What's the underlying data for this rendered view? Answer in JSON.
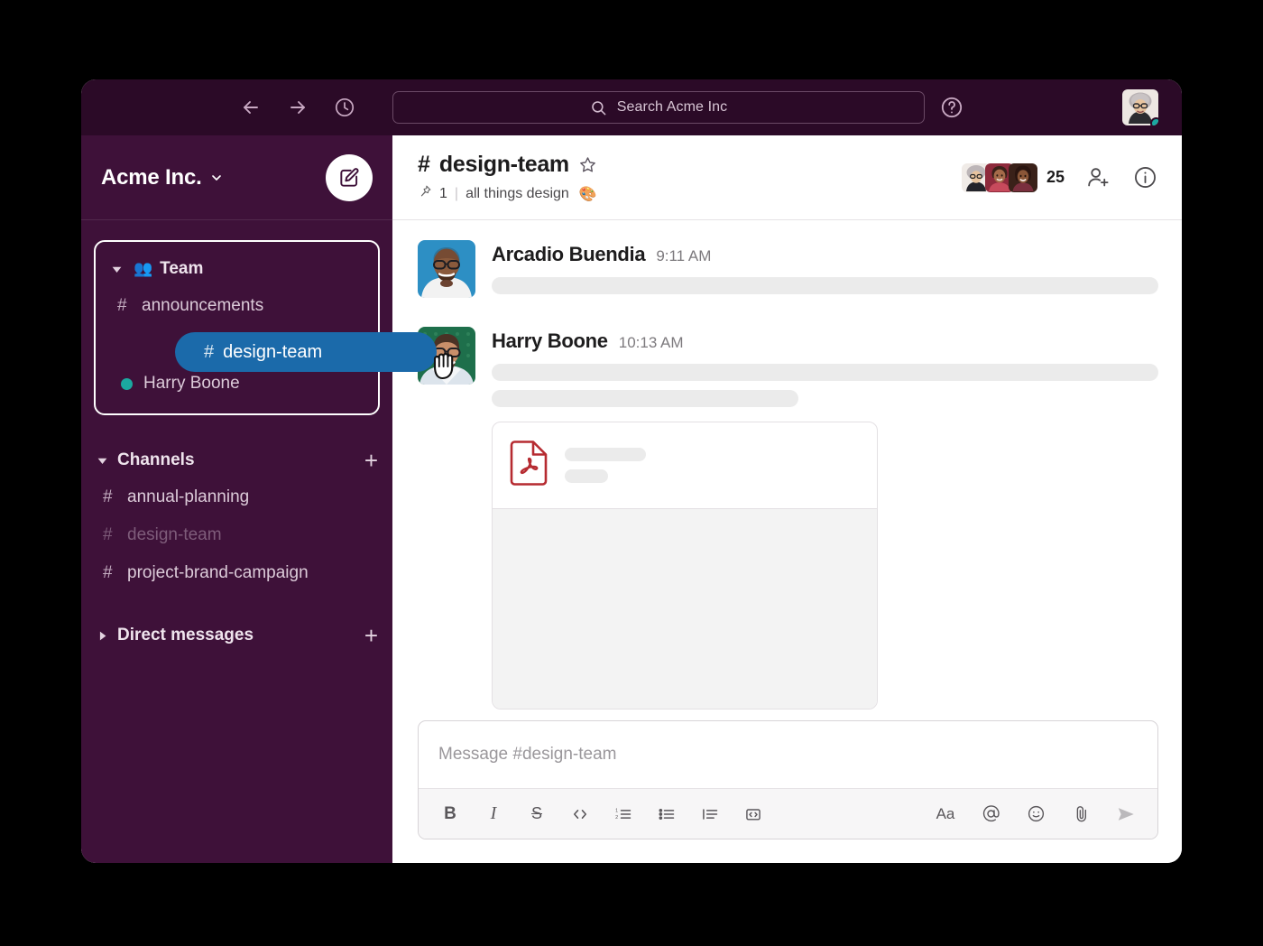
{
  "topbar": {
    "back_icon": "arrow-left-icon",
    "forward_icon": "arrow-right-icon",
    "history_icon": "clock-icon",
    "search_placeholder": "Search Acme Inc",
    "search_icon": "search-icon",
    "help_icon": "question-circle-icon",
    "avatar_icon": "user-avatar"
  },
  "sidebar": {
    "workspace_name": "Acme Inc.",
    "workspace_caret_icon": "chevron-down-icon",
    "compose_icon": "compose-pencil-icon",
    "team_section": {
      "label": "Team",
      "emoji": "👥",
      "caret_icon": "caret-down-icon",
      "items": [
        {
          "type": "channel",
          "hash": "#",
          "label": "announcements",
          "muted": false
        },
        {
          "type": "member",
          "label": "Harry Boone",
          "presence": "active"
        }
      ]
    },
    "drag_pill": {
      "hash": "#",
      "label": "design-team",
      "cursor_icon": "grab-hand-cursor"
    },
    "channels_section": {
      "label": "Channels",
      "caret_icon": "caret-down-icon",
      "add_label": "+",
      "items": [
        {
          "hash": "#",
          "label": "annual-planning",
          "muted": false
        },
        {
          "hash": "#",
          "label": "design-team",
          "muted": true
        },
        {
          "hash": "#",
          "label": "project-brand-campaign",
          "muted": false
        }
      ]
    },
    "dm_section": {
      "label": "Direct messages",
      "caret_icon": "caret-right-icon",
      "add_label": "+"
    }
  },
  "channel_header": {
    "hash": "#",
    "name": "design-team",
    "star_icon": "star-outline-icon",
    "pin_icon": "pin-icon",
    "pin_count": "1",
    "separator": "|",
    "topic": "all things design",
    "topic_emoji": "🎨",
    "member_count": "25",
    "add_member_icon": "person-plus-icon",
    "info_icon": "info-circle-icon"
  },
  "messages": [
    {
      "author": "Arcadio Buendia",
      "time": "9:11 AM",
      "avatar_icon": "user-avatar",
      "lines": [
        100
      ],
      "attachment": null
    },
    {
      "author": "Harry Boone",
      "time": "10:13 AM",
      "avatar_icon": "user-avatar",
      "lines": [
        100,
        46
      ],
      "attachment": {
        "file_icon": "pdf-file-icon",
        "title_placeholder": true,
        "subtitle_placeholder": true
      }
    }
  ],
  "composer": {
    "placeholder": "Message #design-team",
    "toolbar_left": [
      {
        "name": "bold-button",
        "label": "B"
      },
      {
        "name": "italic-button",
        "label": "I"
      },
      {
        "name": "strikethrough-button",
        "label": "S"
      },
      {
        "name": "code-button",
        "label": "</>"
      },
      {
        "name": "ordered-list-button",
        "label": ""
      },
      {
        "name": "bulleted-list-button",
        "label": ""
      },
      {
        "name": "blockquote-button",
        "label": ""
      },
      {
        "name": "code-block-button",
        "label": ""
      }
    ],
    "toolbar_right": [
      {
        "name": "formatting-button",
        "label": "Aa"
      },
      {
        "name": "mention-button",
        "label": "@"
      },
      {
        "name": "emoji-button",
        "label": ""
      },
      {
        "name": "attach-button",
        "label": ""
      },
      {
        "name": "send-button",
        "label": ""
      }
    ]
  },
  "colors": {
    "sidebar_bg": "#3E1139",
    "topbar_bg": "#2B0A27",
    "accent_blue": "#1B6AAA",
    "presence_green": "#1BA8A0",
    "pdf_red": "#B62B31",
    "page_bg": "#000000"
  }
}
